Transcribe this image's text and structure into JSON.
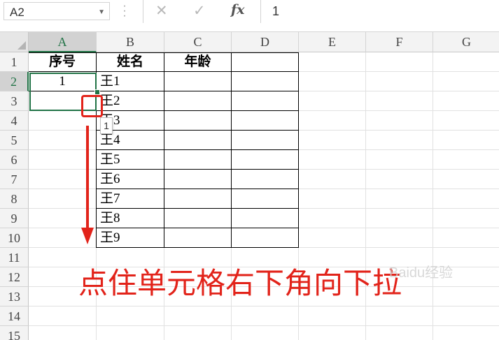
{
  "formula_bar": {
    "name_box": "A2",
    "cancel_icon": "✕",
    "confirm_icon": "✓",
    "function_icon": "fx",
    "formula_value": "1"
  },
  "columns": [
    "A",
    "B",
    "C",
    "D",
    "E",
    "F",
    "G"
  ],
  "rows": [
    "1",
    "2",
    "3",
    "4",
    "5",
    "6",
    "7",
    "8",
    "9",
    "10",
    "11",
    "12",
    "13",
    "14",
    "15"
  ],
  "cells": {
    "A1": "序号",
    "B1": "姓名",
    "C1": "年龄",
    "A2": "1",
    "B2": "王1",
    "B3": "王2",
    "B4": "王3",
    "B5": "王4",
    "B6": "王5",
    "B7": "王6",
    "B8": "王7",
    "B9": "王8",
    "B10": "王9"
  },
  "fill_tooltip": "1",
  "annotation": {
    "caption": "点住单元格右下角向下拉",
    "color": "#e2231a"
  },
  "watermark": "Baidu经验",
  "colors": {
    "selection": "#217346",
    "annotation": "#e2231a"
  }
}
